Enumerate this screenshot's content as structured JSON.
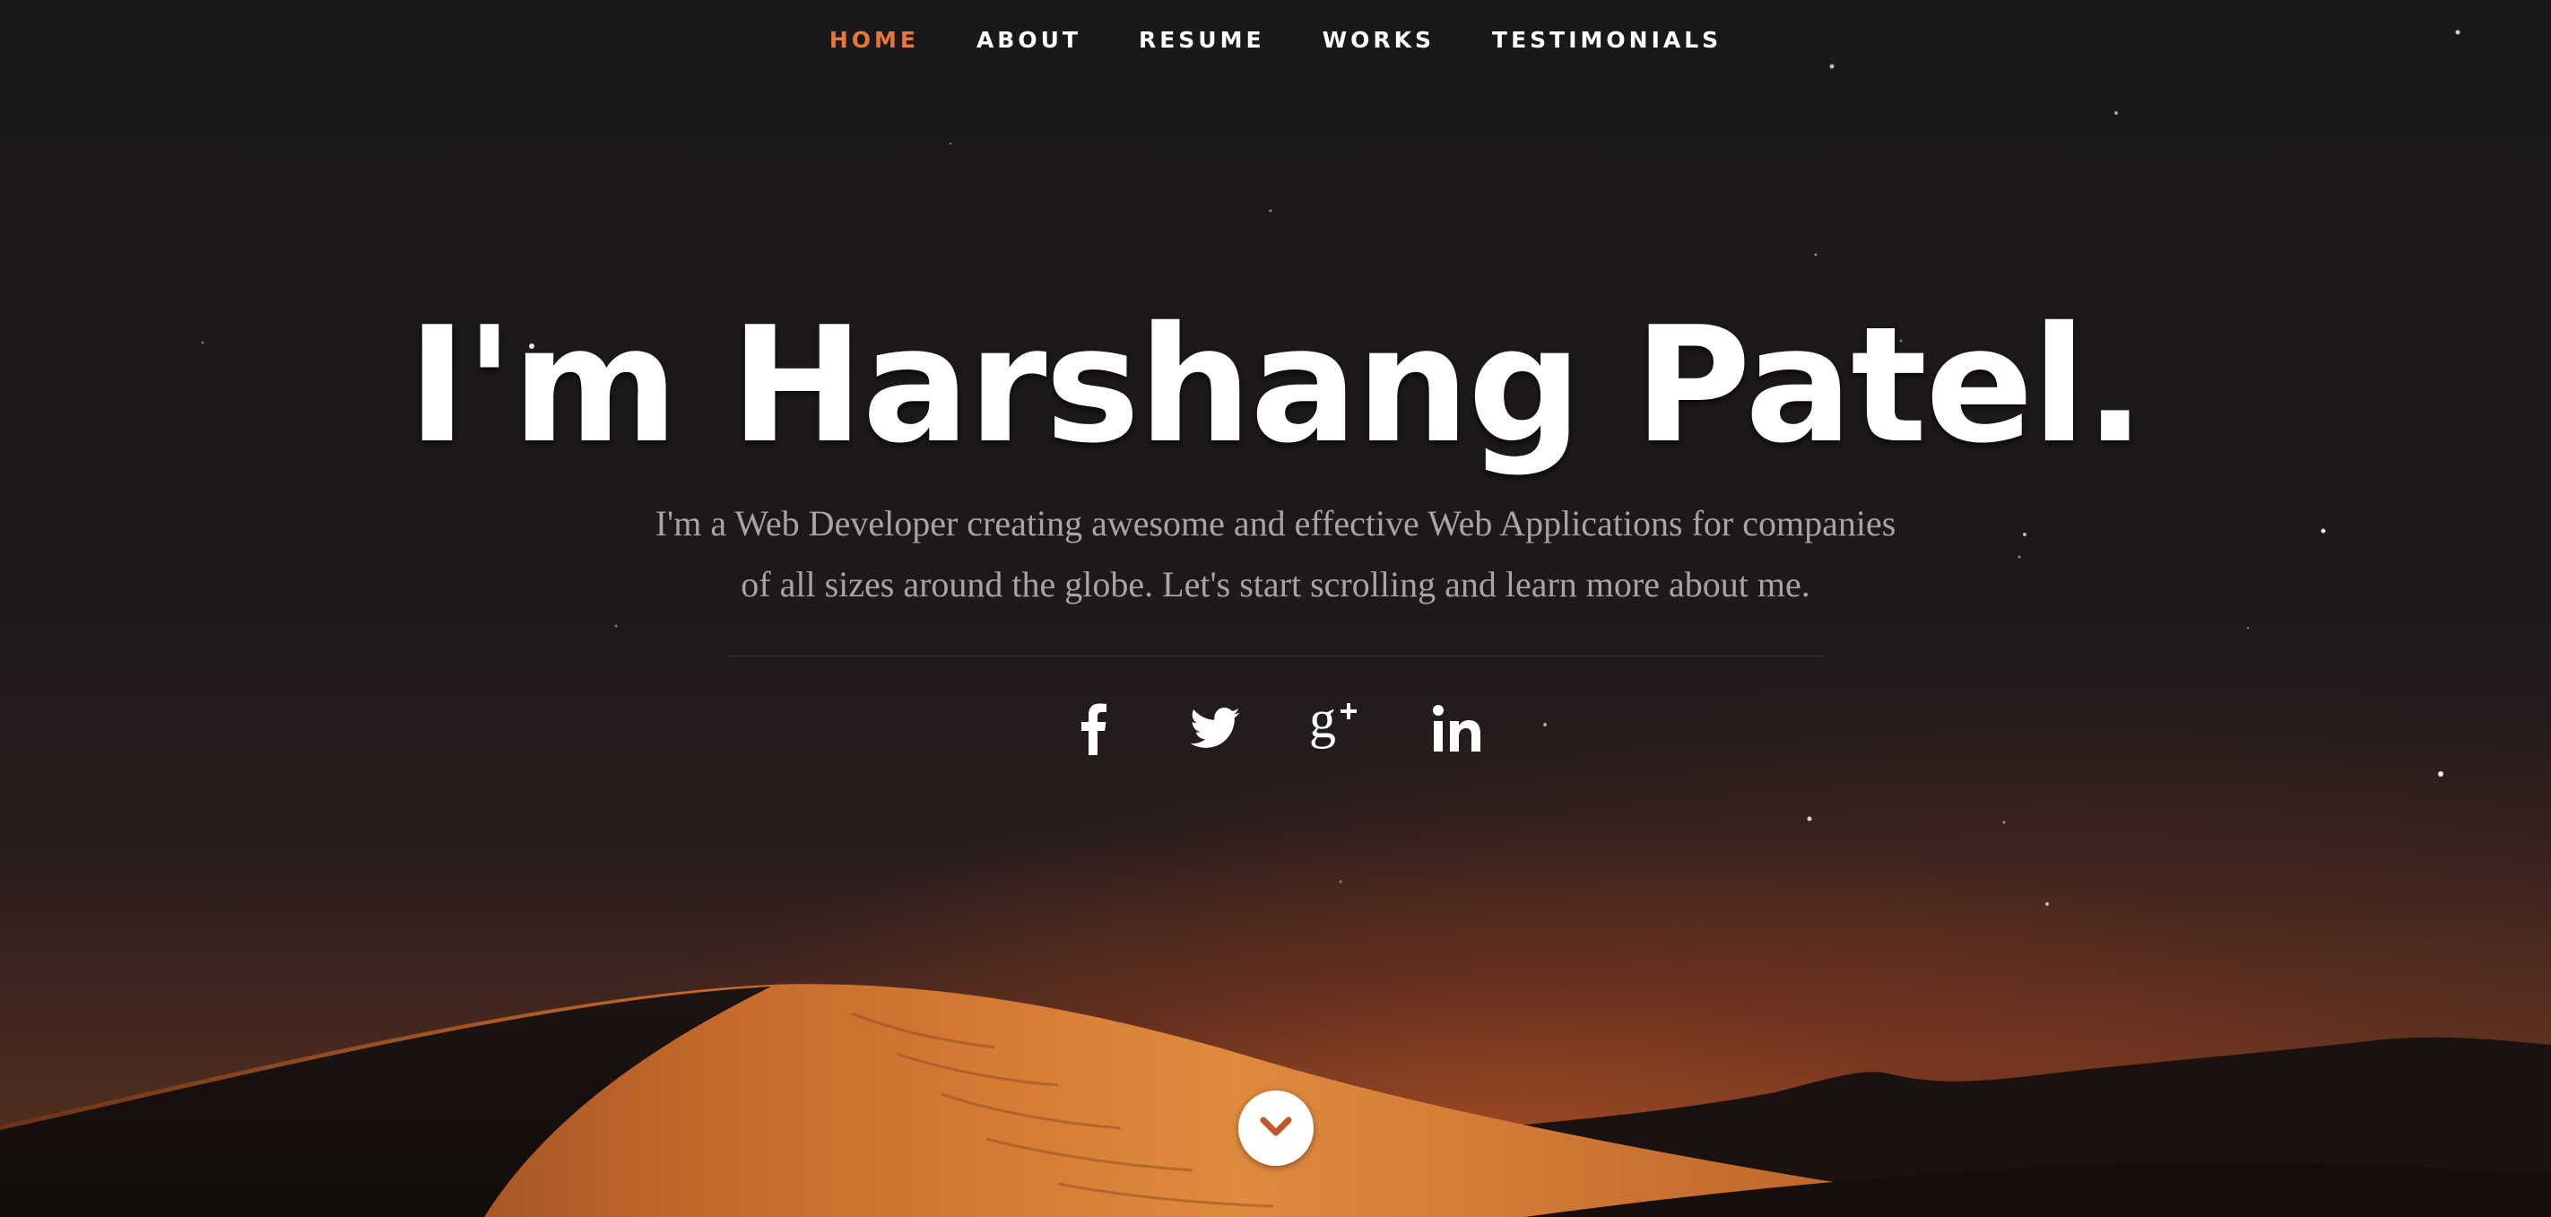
{
  "nav": {
    "items": [
      {
        "label": "HOME",
        "active": true
      },
      {
        "label": "ABOUT",
        "active": false
      },
      {
        "label": "RESUME",
        "active": false
      },
      {
        "label": "WORKS",
        "active": false
      },
      {
        "label": "TESTIMONIALS",
        "active": false
      }
    ],
    "active_color": "#e8753a",
    "text_color": "#ffffff"
  },
  "banner": {
    "headline": "I'm Harshang Patel.",
    "intro": "I'm a Web Developer creating awesome and effective Web Applications for companies of all sizes around the globe. Let's start scrolling and learn more about me."
  },
  "social": [
    {
      "name": "facebook",
      "icon": "facebook-icon"
    },
    {
      "name": "twitter",
      "icon": "twitter-icon"
    },
    {
      "name": "google-plus",
      "icon": "google-plus-icon"
    },
    {
      "name": "linkedin",
      "icon": "linkedin-icon"
    }
  ],
  "scroll_down": {
    "icon": "chevron-down-icon",
    "icon_color": "#c2552a"
  },
  "colors": {
    "background": "#1b181a",
    "dune_highlight": "#d9772f",
    "intro_text": "#a8a4a2"
  }
}
